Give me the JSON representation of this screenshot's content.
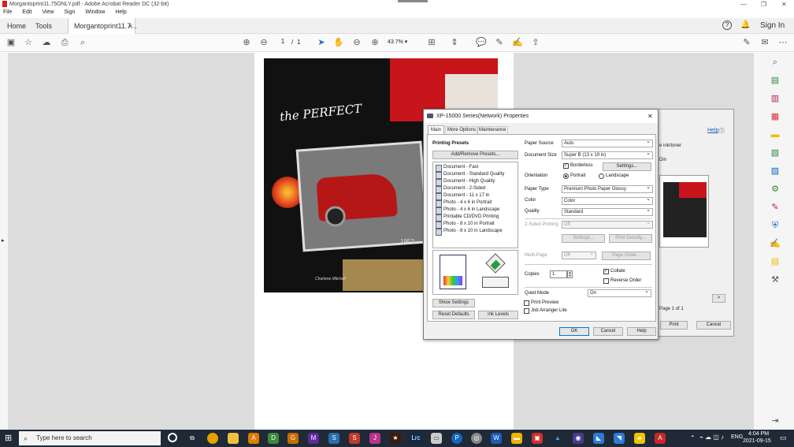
{
  "window": {
    "title": "Morgantoprint11.75ONLY.pdf - Adobe Acrobat Reader DC (32-bit)",
    "min": "—",
    "max": "❐",
    "close": "✕"
  },
  "menu": [
    "File",
    "Edit",
    "View",
    "Sign",
    "Window",
    "Help"
  ],
  "tabs": {
    "home": "Home",
    "tools": "Tools",
    "doc": "Morgantoprint11.7...",
    "close": "×",
    "signin": "Sign In"
  },
  "toolbar": {
    "page_current": "1",
    "page_sep": "/",
    "page_total": "1",
    "zoom": "43.7%"
  },
  "dialog": {
    "title": "XP-15000 Series(Network) Properties",
    "close": "✕",
    "tabs": [
      "Main",
      "More Options",
      "Maintenance"
    ],
    "printing_presets": "Printing Presets",
    "add_remove": "Add/Remove Presets...",
    "presets": [
      "Document - Fast",
      "Document - Standard Quality",
      "Document - High Quality",
      "Document - 2-Sided",
      "Document - 11 x 17 in",
      "Photo - 4 x 6 in Portrait",
      "Photo - 4 x 6 in Landscape",
      "Printable CD/DVD Printing",
      "Photo - 8 x 10 in Portrait",
      "Photo - 8 x 10 in Landscape"
    ],
    "show_settings": "Show Settings",
    "reset_defaults": "Reset Defaults",
    "ink_levels": "Ink Levels",
    "paper_source_label": "Paper Source",
    "paper_source": "Auto",
    "document_size_label": "Document Size",
    "document_size": "Super B (13 x 19 in)",
    "borderless": "Borderless",
    "settings": "Settings...",
    "orientation_label": "Orientation",
    "portrait": "Portrait",
    "landscape": "Landscape",
    "paper_type_label": "Paper Type",
    "paper_type": "Premium Photo Paper Glossy",
    "color_label": "Color",
    "color": "Color",
    "quality_label": "Quality",
    "quality": "Standard",
    "two_sided_label": "2-Sided Printing",
    "two_sided": "Off",
    "settings2": "Settings...",
    "print_density": "Print Density...",
    "multipage_label": "Multi-Page",
    "multipage": "Off",
    "page_order": "Page Order...",
    "copies_label": "Copies",
    "copies": "1",
    "collate": "Collate",
    "reverse_order": "Reverse Order",
    "quiet_mode_label": "Quiet Mode",
    "quiet_mode": "On",
    "print_preview": "Print Preview",
    "job_arranger": "Job Arranger Lite",
    "ok": "OK",
    "cancel": "Cancel",
    "help": "Help"
  },
  "print_dialog": {
    "help": "Help",
    "ink_toner": "e ink/toner",
    "pin": "Din",
    "page_of": "Page 1 of 1",
    "next": ">",
    "print": "Print",
    "cancel": "Cancel"
  },
  "artwork": {
    "year": "1952",
    "signature": "Charlene Mitchell",
    "title_text": "the PERFECT"
  },
  "taskbar": {
    "search": "Type here to search",
    "time": "4:04 PM",
    "date": "2021-09-15",
    "lang": "ENG"
  }
}
